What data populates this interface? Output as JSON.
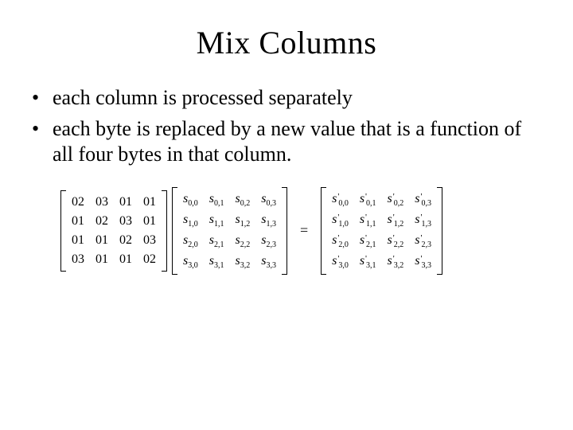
{
  "title": "Mix Columns",
  "bullets": [
    "each column is processed separately",
    "each byte is replaced by a new value that is a function of all four bytes in that column."
  ],
  "equation": {
    "coeff_matrix": [
      [
        "02",
        "03",
        "01",
        "01"
      ],
      [
        "01",
        "02",
        "03",
        "01"
      ],
      [
        "01",
        "01",
        "02",
        "03"
      ],
      [
        "03",
        "01",
        "01",
        "02"
      ]
    ],
    "state_matrix": {
      "symbol": "s",
      "indices": [
        [
          "0,0",
          "0,1",
          "0,2",
          "0,3"
        ],
        [
          "1,0",
          "1,1",
          "1,2",
          "1,3"
        ],
        [
          "2,0",
          "2,1",
          "2,2",
          "2,3"
        ],
        [
          "3,0",
          "3,1",
          "3,2",
          "3,3"
        ]
      ]
    },
    "result_matrix": {
      "symbol": "s",
      "prime": true,
      "indices": [
        [
          "0,0",
          "0,1",
          "0,2",
          "0,3"
        ],
        [
          "1,0",
          "1,1",
          "1,2",
          "1,3"
        ],
        [
          "2,0",
          "2,1",
          "2,2",
          "2,3"
        ],
        [
          "3,0",
          "3,1",
          "3,2",
          "3,3"
        ]
      ]
    },
    "operator": "="
  }
}
